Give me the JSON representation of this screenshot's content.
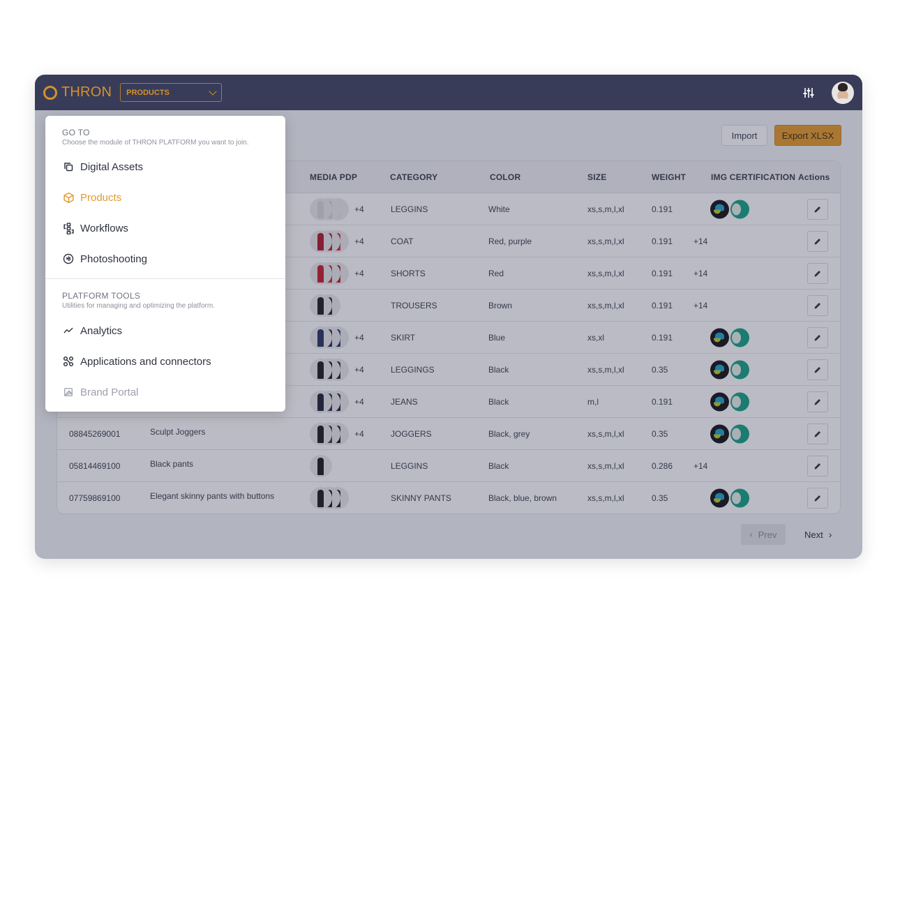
{
  "header": {
    "logo_text": "THRON",
    "module_select": {
      "value": "PRODUCTS"
    },
    "settings_icon": "sliders-icon",
    "avatar_icon": "user-avatar"
  },
  "toolbar": {
    "import_label": "Import",
    "export_label": "Export XLSX"
  },
  "table": {
    "columns": [
      "MEDIA PDP",
      "CATEGORY",
      "COLOR",
      "SIZE",
      "WEIGHT",
      "IMG CERTIFICATION",
      "Actions"
    ],
    "rows": [
      {
        "id": "",
        "name": "",
        "media_more": "+4",
        "thumb_colors": [
          "#d7d8d9",
          "#cfd0d2",
          "#e3e3e3"
        ],
        "category": "LEGGINS",
        "color": "White",
        "size": "xs,s,m,l,xl",
        "weight": "0.191",
        "cert": "badges",
        "cert_more": ""
      },
      {
        "id": "",
        "name": "",
        "media_more": "+4",
        "thumb_colors": [
          "#b3182b",
          "#c11d30",
          "#d2283a"
        ],
        "category": "COAT",
        "color": "Red, purple",
        "size": "xs,s,m,l,xl",
        "weight": "0.191",
        "cert": "more",
        "cert_more": "+14"
      },
      {
        "id": "",
        "name": "",
        "media_more": "+4",
        "thumb_colors": [
          "#c4202e",
          "#d12a36",
          "#c01e2c"
        ],
        "category": "SHORTS",
        "color": "Red",
        "size": "xs,s,m,l,xl",
        "weight": "0.191",
        "cert": "more",
        "cert_more": "+14"
      },
      {
        "id": "",
        "name": "",
        "media_more": "",
        "thumb_colors": [
          "#1e1e22",
          "#25252a"
        ],
        "category": "TROUSERS",
        "color": "Brown",
        "size": "xs,s,m,l,xl",
        "weight": "0.191",
        "cert": "more",
        "cert_more": "+14"
      },
      {
        "id": "",
        "name": "",
        "media_more": "+4",
        "thumb_colors": [
          "#2a3460",
          "#1f2a55",
          "#27336a"
        ],
        "category": "SKIRT",
        "color": "Blue",
        "size": "xs,xl",
        "weight": "0.191",
        "cert": "badges",
        "cert_more": ""
      },
      {
        "id": "",
        "name": "",
        "media_more": "+4",
        "thumb_colors": [
          "#1c1c20",
          "#18181c",
          "#222226"
        ],
        "category": "LEGGINGS",
        "color": "Black",
        "size": "xs,s,m,l,xl",
        "weight": "0.35",
        "cert": "badges",
        "cert_more": ""
      },
      {
        "id": "",
        "name": "",
        "media_more": "+4",
        "thumb_colors": [
          "#1f2438",
          "#2b2f45",
          "#1b2036"
        ],
        "category": "JEANS",
        "color": "Black",
        "size": "m,l",
        "weight": "0.191",
        "cert": "badges",
        "cert_more": ""
      },
      {
        "id": "08845269001",
        "name": "Sculpt Joggers",
        "media_more": "+4",
        "thumb_colors": [
          "#1c1c20",
          "#3a3a3e",
          "#18181c"
        ],
        "category": "JOGGERS",
        "color": "Black, grey",
        "size": "xs,s,m,l,xl",
        "weight": "0.35",
        "cert": "badges",
        "cert_more": ""
      },
      {
        "id": "05814469100",
        "name": "Black pants",
        "media_more": "",
        "thumb_colors": [
          "#1a1a1e"
        ],
        "category": "LEGGINS",
        "color": "Black",
        "size": "xs,s,m,l,xl",
        "weight": "0.286",
        "cert": "more",
        "cert_more": "+14"
      },
      {
        "id": "07759869100",
        "name": "Elegant skinny pants with buttons",
        "media_more": "",
        "thumb_colors": [
          "#1c1c20",
          "#18181c",
          "#222226"
        ],
        "category": "SKINNY PANTS",
        "color": "Black, blue, brown",
        "size": "xs,s,m,l,xl",
        "weight": "0.35",
        "cert": "badges",
        "cert_more": ""
      }
    ]
  },
  "pagination": {
    "prev_label": "Prev",
    "next_label": "Next"
  },
  "menu": {
    "goto": {
      "title": "GO TO",
      "subtitle": "Choose the module of THRON PLATFORM you want to join.",
      "items": [
        {
          "label": "Digital Assets",
          "icon": "digital-assets-icon",
          "state": "normal"
        },
        {
          "label": "Products",
          "icon": "cube-icon",
          "state": "active"
        },
        {
          "label": "Workflows",
          "icon": "workflow-icon",
          "state": "normal"
        },
        {
          "label": "Photoshooting",
          "icon": "aperture-icon",
          "state": "normal"
        }
      ]
    },
    "tools": {
      "title": "PLATFORM TOOLS",
      "subtitle": "Utilities for managing and optimizing the platform.",
      "items": [
        {
          "label": "Analytics",
          "icon": "analytics-icon",
          "state": "normal"
        },
        {
          "label": "Applications and connectors",
          "icon": "connectors-icon",
          "state": "normal"
        },
        {
          "label": "Brand Portal",
          "icon": "brand-portal-icon",
          "state": "disabled"
        }
      ]
    }
  },
  "colors": {
    "topbar": "#383c59",
    "accent": "#e19a32",
    "export_button": "#e89b28"
  }
}
